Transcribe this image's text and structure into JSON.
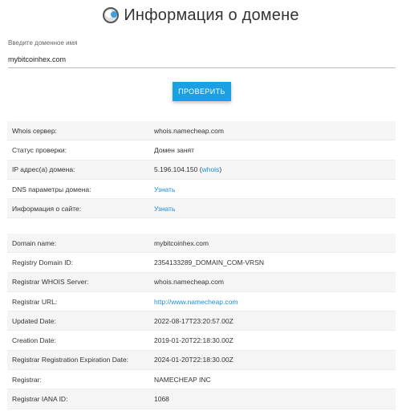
{
  "header": {
    "title": "Информация о домене",
    "logo_icon": "globe-logo-icon"
  },
  "form": {
    "label": "Введите доменное имя",
    "value": "mybitcoinhex.com",
    "button_label": "ПРОВЕРИТЬ"
  },
  "colors": {
    "accent": "#1ba1e2",
    "link": "#1a8fd8",
    "row_alt": "#f5f5f5"
  },
  "check": {
    "whois_server_k": "Whois сервер:",
    "whois_server_v": "whois.namecheap.com",
    "status_k": "Статус проверки:",
    "status_v": "Домен занят",
    "ip_k": "IP адрес(а) домена:",
    "ip_v": "5.196.104.150",
    "ip_paren_open": "(",
    "ip_whois_link": "whois",
    "ip_paren_close": ")",
    "dns_k": "DNS параметры домена:",
    "dns_v": "Узнать",
    "site_k": "Информация о сайте:",
    "site_v": "Узнать"
  },
  "whois": {
    "rows": [
      {
        "k": "Domain name:",
        "v": "mybitcoinhex.com"
      },
      {
        "k": "Registry Domain ID:",
        "v": "2354133289_DOMAIN_COM-VRSN"
      },
      {
        "k": "Registrar WHOIS Server:",
        "v": "whois.namecheap.com"
      },
      {
        "k": "Registrar URL:",
        "v": "http://www.namecheap.com"
      },
      {
        "k": "Updated Date:",
        "v": "2022-08-17T23:20:57.00Z"
      },
      {
        "k": "Creation Date:",
        "v": "2019-01-20T22:18:30.00Z"
      },
      {
        "k": "Registrar Registration Expiration Date:",
        "v": "2024-01-20T22:18:30.00Z"
      },
      {
        "k": "Registrar:",
        "v": "NAMECHEAP INC"
      },
      {
        "k": "Registrar IANA ID:",
        "v": "1068"
      }
    ]
  }
}
